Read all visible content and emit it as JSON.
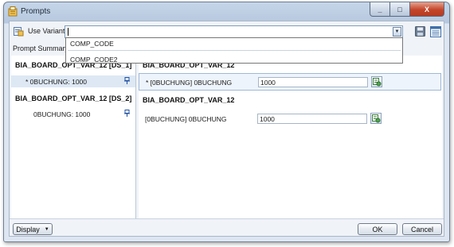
{
  "window": {
    "title": "Prompts",
    "minimize_glyph": "_",
    "maximize_glyph": "□",
    "close_glyph": "X"
  },
  "variant": {
    "label": "Use Variant",
    "value": "",
    "options": [
      "COMP_CODE",
      "COMP_CODE2"
    ]
  },
  "prompt_summary": {
    "label": "Prompt Summary",
    "groups": [
      {
        "title": "BIA_BOARD_OPT_VAR_12 [DS_1]",
        "items": [
          {
            "text": "* 0BUCHUNG: 1000",
            "selected": true
          }
        ]
      },
      {
        "title": "BIA_BOARD_OPT_VAR_12 [DS_2]",
        "items": [
          {
            "text": "0BUCHUNG: 1000",
            "selected": false
          }
        ]
      }
    ]
  },
  "details": [
    {
      "title": "BIA_BOARD_OPT_VAR_12",
      "rows": [
        {
          "label": "* [0BUCHUNG] 0BUCHUNG",
          "value": "1000",
          "selected": true
        }
      ]
    },
    {
      "title": "BIA_BOARD_OPT_VAR_12",
      "rows": [
        {
          "label": "[0BUCHUNG] 0BUCHUNG",
          "value": "1000",
          "selected": false
        }
      ]
    }
  ],
  "footer": {
    "display_label": "Display",
    "ok_label": "OK",
    "cancel_label": "Cancel"
  },
  "colors": {
    "accent": "#3a6ea5",
    "selection": "#dde8f4"
  },
  "icons": {
    "app": "prompts-app-icon",
    "variant": "variant-icon",
    "save": "save-icon",
    "manage": "manage-variants-icon",
    "pin": "pin-icon",
    "value_help": "value-help-icon"
  }
}
